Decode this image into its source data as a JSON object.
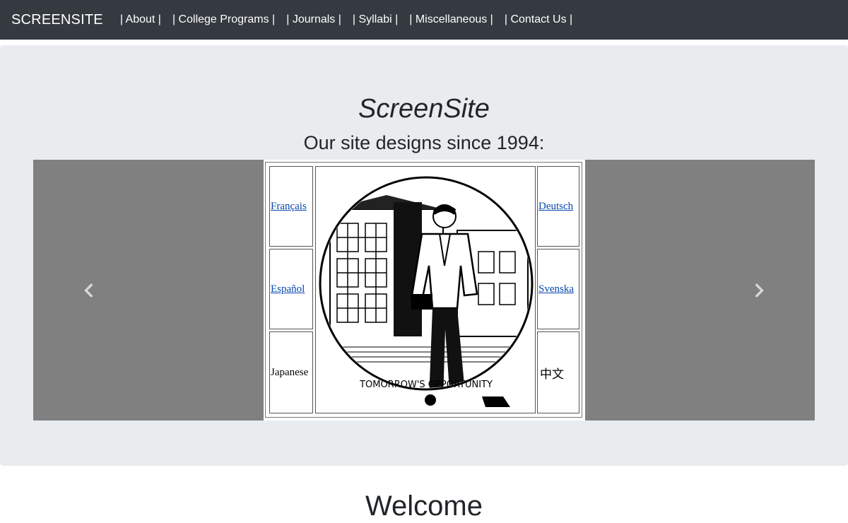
{
  "navbar": {
    "brand": "SCREENSITE",
    "links": [
      "| About |",
      "| College Programs |",
      "| Journals |",
      "| Syllabi |",
      "| Miscellaneous |",
      "| Contact Us |"
    ]
  },
  "hero": {
    "title": "ScreenSite",
    "subtitle": "Our site designs since 1994:"
  },
  "carousel": {
    "prev_icon": "chevron-left-icon",
    "next_icon": "chevron-right-icon",
    "slide": {
      "left_links": [
        "Français",
        "Español",
        "Japanese"
      ],
      "right_links": [
        "Deutsch",
        "Svenska",
        "中文"
      ],
      "image_caption": "TOMORROW'S OPPORTUNITY"
    }
  },
  "main": {
    "heading": "Welcome"
  },
  "colors": {
    "navbar_bg": "#343a40",
    "jumbotron_bg": "#e9ecef",
    "carousel_bg": "#808080",
    "link": "#0645ad"
  }
}
